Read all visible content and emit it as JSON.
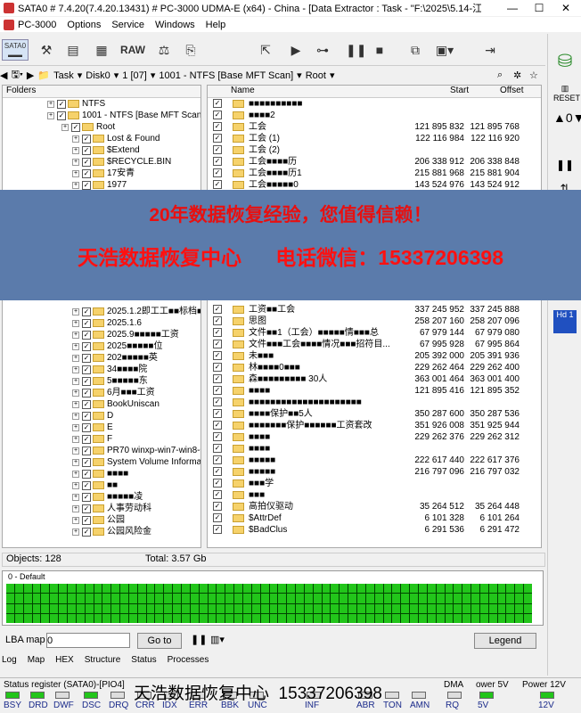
{
  "window": {
    "title": "SATA0 # 7.4.20(7.4.20.13431) # PC-3000 UDMA-E (x64) - China - [Data Extractor : Task - \"F:\\2025\\5.14-江TH1T开盘6...",
    "controls": [
      "—",
      "☐",
      "✕"
    ]
  },
  "menu": {
    "app_name": "PC-3000",
    "items": [
      "Options",
      "Service",
      "Windows",
      "Help"
    ]
  },
  "toolbar": {
    "sata_label": "SATA0",
    "raw_label": "RAW"
  },
  "address": {
    "task": "Task",
    "disk": "Disk0",
    "part": "1 [07]",
    "volume": "1001 - NTFS [Base MFT Scan]",
    "root": "Root"
  },
  "tree": {
    "header": "Folders",
    "top": [
      {
        "label": "NTFS"
      },
      {
        "label": "1001 - NTFS [Base MFT Scan]"
      },
      {
        "label": "Root"
      }
    ],
    "items_upper": [
      "Lost & Found",
      "$Extend",
      "$RECYCLE.BIN",
      "17安青",
      "1977"
    ],
    "items_lower": [
      "2025.1.2即工工■■标档■",
      "2025.1.6",
      "2025.9■■■■■工资",
      "2025■■■■■位",
      "202■■■■■英",
      "34■■■■院",
      "5■■■■■东",
      "6月■■■工资",
      "BookUniscan",
      "D",
      "E",
      "F",
      "PR70 winxp-win7-win8-0",
      "System Volume Informati",
      "■■■■",
      "■■",
      "■■■■■凌",
      "人事劳动科",
      "公园",
      "公园风险金"
    ]
  },
  "filelist": {
    "columns": {
      "name": "Name",
      "start": "Start",
      "offset": "Offset"
    },
    "rows_upper": [
      {
        "name": "■■■■■■■■■■",
        "start": "",
        "offset": ""
      },
      {
        "name": "■■■■2",
        "start": "",
        "offset": ""
      },
      {
        "name": "工会",
        "start": "121 895 832",
        "offset": "121 895 768"
      },
      {
        "name": "工会 (1)",
        "start": "122 116 984",
        "offset": "122 116 920"
      },
      {
        "name": "工会 (2)",
        "start": "",
        "offset": ""
      },
      {
        "name": "工会■■■■历",
        "start": "206 338 912",
        "offset": "206 338 848"
      },
      {
        "name": "工会■■■■历1",
        "start": "215 881 968",
        "offset": "215 881 904"
      },
      {
        "name": "工会■■■■■0",
        "start": "143 524 976",
        "offset": "143 524 912"
      }
    ],
    "rows_lower": [
      {
        "name": "工资■■工会",
        "start": "337 245 952",
        "offset": "337 245 888"
      },
      {
        "name": "思图",
        "start": "258 207 160",
        "offset": "258 207 096"
      },
      {
        "name": "文件■■1（工会）■■■■■情■■■总",
        "start": "67 979 144",
        "offset": "67 979 080"
      },
      {
        "name": "文件■■■工会■■■■情况■■■招符目...",
        "start": "67 995 928",
        "offset": "67 995 864"
      },
      {
        "name": "未■■■",
        "start": "205 392 000",
        "offset": "205 391 936"
      },
      {
        "name": "林■■■■0■■■",
        "start": "229 262 464",
        "offset": "229 262 400"
      },
      {
        "name": "森■■■■■■■■■ 30人",
        "start": "363 001 464",
        "offset": "363 001 400"
      },
      {
        "name": "■■■■",
        "start": "121 895 416",
        "offset": "121 895 352"
      },
      {
        "name": "■■■■■■■■■■■■■■■■■■■■■",
        "start": "",
        "offset": ""
      },
      {
        "name": "■■■■保护■■5人",
        "start": "350 287 600",
        "offset": "350 287 536"
      },
      {
        "name": "■■■■■■■保护■■■■■■工资套改",
        "start": "351 926 008",
        "offset": "351 925 944"
      },
      {
        "name": "■■■■",
        "start": "229 262 376",
        "offset": "229 262 312"
      },
      {
        "name": "■■■■",
        "start": "",
        "offset": ""
      },
      {
        "name": "■■■■■",
        "start": "222 617 440",
        "offset": "222 617 376"
      },
      {
        "name": "■■■■■",
        "start": "216 797 096",
        "offset": "216 797 032"
      },
      {
        "name": "■■■学",
        "start": "",
        "offset": ""
      },
      {
        "name": "■■■",
        "start": "",
        "offset": ""
      },
      {
        "name": "高拍仪驱动",
        "start": "35 264 512",
        "offset": "35 264 448"
      },
      {
        "name": "$AttrDef",
        "start": "6 101 328",
        "offset": "6 101 264"
      },
      {
        "name": "$BadClus",
        "start": "6 291 536",
        "offset": "6 291 472"
      }
    ]
  },
  "banner": {
    "line1": "20年数据恢复经验，您值得信赖！",
    "line2": "天浩数据恢复中心      电话微信：15337206398"
  },
  "status": {
    "objects": "Objects: 128",
    "total": "Total: 3.57 Gb",
    "default_label": "0 - Default"
  },
  "lba": {
    "label": "LBA map",
    "value": "0",
    "goto": "Go to",
    "legend": "Legend"
  },
  "tabs": [
    "Log",
    "Map",
    "HEX",
    "Structure",
    "Status",
    "Processes"
  ],
  "status_register": {
    "label": "Status register (SATA0)-[PIO4]",
    "leds": [
      {
        "name": "BSY",
        "on": true
      },
      {
        "name": "DRD",
        "on": true
      },
      {
        "name": "DWF",
        "on": false
      },
      {
        "name": "DSC",
        "on": true
      },
      {
        "name": "DRQ",
        "on": false
      },
      {
        "name": "CRR",
        "on": false
      },
      {
        "name": "IDX",
        "on": false
      },
      {
        "name": "ERR",
        "on": false
      },
      {
        "name": "BBK",
        "on": false
      },
      {
        "name": "UNC",
        "on": false
      },
      {
        "name": "INF",
        "on": false
      },
      {
        "name": "ABR",
        "on": false
      },
      {
        "name": "TON",
        "on": false
      },
      {
        "name": "AMN",
        "on": false
      },
      {
        "name": "RQ",
        "on": false
      },
      {
        "name": "5V",
        "on": true
      },
      {
        "name": "12V",
        "on": true
      }
    ],
    "dma_label": "DMA",
    "power5_label": "ower 5V",
    "power12_label": "Power 12V"
  },
  "watermark": "天浩数据恢复中心  15337206398",
  "colors": {
    "led_on": "#22c51a",
    "banner_bg": "#5b7bab",
    "banner_text": "#ff1010"
  }
}
